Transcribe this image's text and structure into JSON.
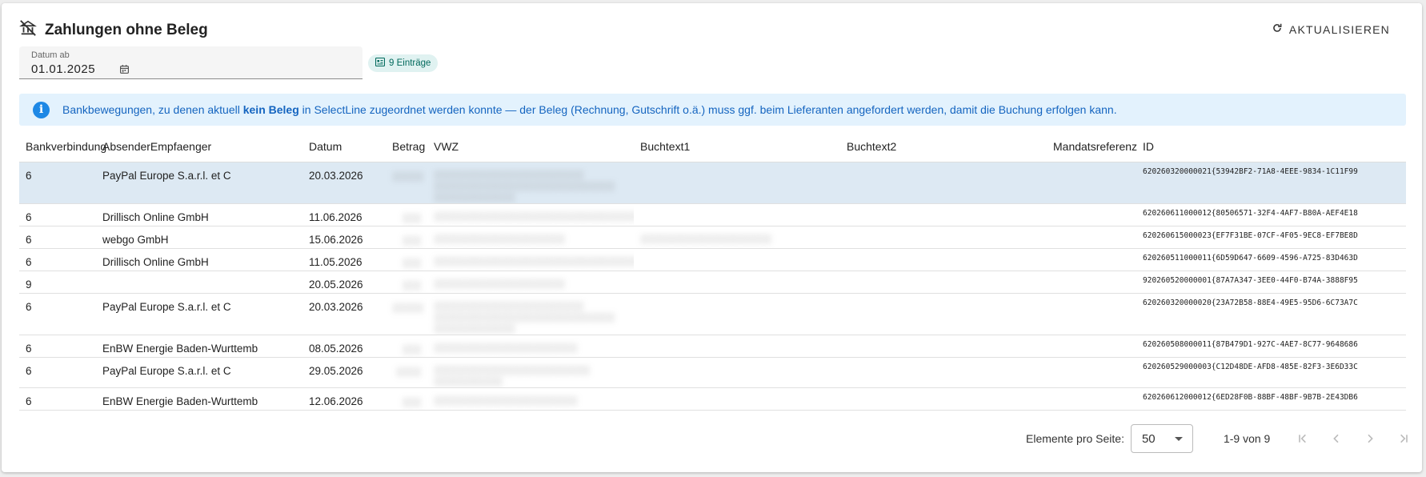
{
  "header": {
    "title": "Zahlungen ohne Beleg",
    "refresh_label": "AKTUALISIEREN"
  },
  "filter": {
    "date_label": "Datum ab",
    "date_value": "01.01.2025"
  },
  "chip": {
    "label": "9 Einträge"
  },
  "info": {
    "pre": "Bankbewegungen, zu denen aktuell ",
    "bold": "kein Beleg",
    "post": " in SelectLine zugeordnet werden konnte — der Beleg (Rechnung, Gutschrift o.ä.) muss ggf. beim Lieferanten angefordert werden, damit die Buchung erfolgen kann."
  },
  "table": {
    "columns": [
      "Bankverbindung",
      "AbsenderEmpfaenger",
      "Datum",
      "Betrag",
      "VWZ",
      "Buchtext1",
      "Buchtext2",
      "Mandatsreferenz",
      "ID"
    ],
    "rows": [
      {
        "bank": "6",
        "name": "PayPal Europe S.a.r.l. et C",
        "date": "20.03.2026",
        "id": "620260320000021{53942BF2-71A8-4EEE-9834-1C11F99"
      },
      {
        "bank": "6",
        "name": "Drillisch Online GmbH",
        "date": "11.06.2026",
        "id": "620260611000012{80506571-32F4-4AF7-B80A-AEF4E18"
      },
      {
        "bank": "6",
        "name": "webgo GmbH",
        "date": "15.06.2026",
        "id": "620260615000023{EF7F31BE-07CF-4F05-9EC8-EF7BE8D"
      },
      {
        "bank": "6",
        "name": "Drillisch Online GmbH",
        "date": "11.05.2026",
        "id": "620260511000011{6D59D647-6609-4596-A725-83D463D"
      },
      {
        "bank": "9",
        "name": "",
        "date": "20.05.2026",
        "id": "920260520000001{87A7A347-3EE0-44F0-B74A-3888F95"
      },
      {
        "bank": "6",
        "name": "PayPal Europe S.a.r.l. et C",
        "date": "20.03.2026",
        "id": "620260320000020{23A72B58-88E4-49E5-95D6-6C73A7C"
      },
      {
        "bank": "6",
        "name": "EnBW Energie Baden-Wurttemb",
        "date": "08.05.2026",
        "id": "620260508000011{87B479D1-927C-4AE7-8C77-9648686"
      },
      {
        "bank": "6",
        "name": "PayPal Europe S.a.r.l. et C",
        "date": "29.05.2026",
        "id": "620260529000003{C12D48DE-AFD8-485E-82F3-3E6D33C"
      },
      {
        "bank": "6",
        "name": "EnBW Energie Baden-Wurttemb",
        "date": "12.06.2026",
        "id": "620260612000012{6ED28F0B-88BF-48BF-9B7B-2E43DB6"
      }
    ]
  },
  "pager": {
    "per_page_label": "Elemente pro Seite:",
    "per_page_value": "50",
    "range_label": "1-9 von 9"
  },
  "icons": {
    "title": "no-bank-icon",
    "refresh": "refresh-icon",
    "calendar": "calendar-icon",
    "chip": "list-badge-icon",
    "info": "info-icon"
  },
  "colors": {
    "accent": "#1e88e5",
    "info_bg": "#e3f2fd",
    "chip_bg": "#e0f2f1",
    "selected_row": "#dde9f3"
  }
}
